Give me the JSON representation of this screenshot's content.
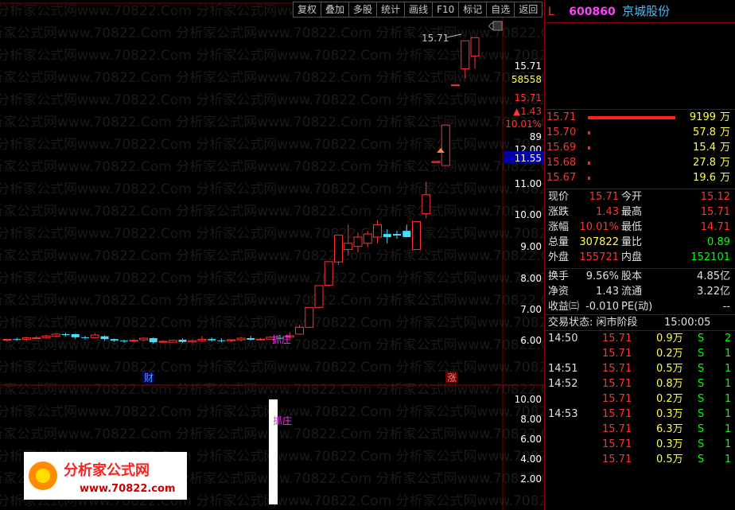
{
  "toolbar": [
    "复权",
    "叠加",
    "多股",
    "统计",
    "画线",
    "F10",
    "标记",
    "自选",
    "返回"
  ],
  "watermark": "分析家公式网www.70822.Com",
  "stock": {
    "flag": "L",
    "code": "600860",
    "name": "京城股份"
  },
  "price_axis": [
    "15.71",
    "58558",
    "15.71",
    "▲1.43",
    "10.01%",
    "89",
    "12.00",
    "11.55",
    "11.00",
    "10.00",
    "9.00",
    "8.00",
    "7.00",
    "6.00"
  ],
  "vol_axis": [
    "10.00",
    "8.00",
    "6.00",
    "4.00",
    "2.00"
  ],
  "markers": {
    "cai": "财",
    "zhang": "涨",
    "zhuazhuang": "抓庄",
    "zhuazhuang2": "抓庄",
    "high_label": "15.71"
  },
  "chart_data": {
    "type": "candlestick",
    "candles": [
      [
        5.99,
        6.01,
        5.95,
        6.03
      ],
      [
        6.02,
        6.0,
        5.96,
        6.06
      ],
      [
        6.01,
        6.06,
        5.98,
        6.1
      ],
      [
        6.06,
        6.06,
        6.03,
        6.12
      ],
      [
        6.07,
        6.12,
        6.04,
        6.17
      ],
      [
        6.11,
        6.18,
        6.08,
        6.22
      ],
      [
        6.18,
        6.15,
        6.11,
        6.22
      ],
      [
        6.18,
        6.08,
        6.03,
        6.2
      ],
      [
        6.08,
        6.07,
        6.01,
        6.12
      ],
      [
        6.07,
        6.15,
        6.04,
        6.22
      ],
      [
        6.11,
        6.02,
        5.98,
        6.14
      ],
      [
        6.02,
        5.97,
        5.93,
        6.04
      ],
      [
        5.97,
        5.96,
        5.9,
        5.99
      ],
      [
        5.96,
        5.98,
        5.93,
        6.02
      ],
      [
        6.0,
        6.05,
        5.96,
        6.07
      ],
      [
        6.05,
        5.92,
        5.88,
        6.07
      ],
      [
        5.92,
        5.95,
        5.9,
        5.98
      ],
      [
        5.92,
        5.98,
        5.92,
        6.0
      ],
      [
        6.0,
        5.93,
        5.9,
        6.04
      ],
      [
        5.93,
        5.97,
        5.9,
        6.0
      ],
      [
        5.97,
        6.01,
        5.92,
        6.12
      ],
      [
        6.02,
        5.98,
        5.95,
        6.07
      ],
      [
        5.98,
        5.97,
        5.92,
        6.04
      ],
      [
        5.97,
        6.0,
        5.92,
        6.02
      ],
      [
        6.0,
        6.05,
        5.95,
        6.09
      ],
      [
        6.05,
        6.0,
        5.97,
        6.12
      ],
      [
        6.0,
        6.02,
        5.97,
        6.06
      ],
      [
        6.02,
        6.08,
        6.0,
        6.12
      ],
      [
        6.06,
        6.05,
        6.0,
        6.12
      ],
      [
        6.08,
        6.13,
        6.03,
        6.24
      ],
      [
        6.18,
        6.4,
        6.16,
        6.48
      ],
      [
        6.4,
        7.04,
        6.38,
        7.04
      ],
      [
        7.04,
        7.74,
        7.0,
        7.74
      ],
      [
        7.75,
        8.51,
        7.7,
        8.51
      ],
      [
        8.5,
        9.36,
        8.4,
        9.36
      ],
      [
        8.9,
        9.1,
        8.7,
        9.7
      ],
      [
        9.0,
        9.3,
        8.8,
        9.45
      ],
      [
        9.1,
        9.4,
        8.98,
        9.5
      ],
      [
        9.3,
        9.7,
        9.1,
        9.85
      ],
      [
        9.4,
        9.3,
        9.1,
        9.55
      ],
      [
        9.4,
        9.35,
        9.25,
        9.5
      ],
      [
        9.5,
        9.3,
        9.3,
        9.7
      ],
      [
        8.9,
        9.8,
        8.9,
        9.8
      ],
      [
        10.05,
        10.66,
        9.9,
        11.08
      ],
      [
        11.7,
        11.73,
        11.7,
        11.73
      ],
      [
        11.6,
        12.9,
        11.6,
        12.9
      ],
      [
        14.19,
        14.19,
        14.19,
        14.19
      ],
      [
        14.71,
        15.61,
        14.4,
        15.61
      ],
      [
        15.12,
        15.71,
        14.71,
        15.71
      ]
    ],
    "vol_spike": 10.0
  },
  "order_book": [
    {
      "p": "15.71",
      "v": "9199",
      "u": "万",
      "bar": true
    },
    {
      "p": "15.70",
      "v": "57.8",
      "u": "万"
    },
    {
      "p": "15.69",
      "v": "15.4",
      "u": "万"
    },
    {
      "p": "15.68",
      "v": "27.8",
      "u": "万"
    },
    {
      "p": "15.67",
      "v": "19.6",
      "u": "万"
    }
  ],
  "quote": [
    [
      "现价",
      "15.71",
      "今开",
      "15.12"
    ],
    [
      "涨跌",
      "1.43",
      "最高",
      "15.71"
    ],
    [
      "涨幅",
      "10.01%",
      "最低",
      "14.71"
    ],
    [
      "总量",
      "307822",
      "量比",
      "0.89"
    ],
    [
      "外盘",
      "155721",
      "内盘",
      "152101"
    ]
  ],
  "stats": [
    [
      "换手",
      "9.56%",
      "股本",
      "4.85亿"
    ],
    [
      "净资",
      "1.43",
      "流通",
      "3.22亿"
    ],
    [
      "收益㈢",
      "-0.010",
      "PE(动)",
      "--"
    ]
  ],
  "status": {
    "label": "交易状态: 闲市阶段",
    "time": "15:00:05"
  },
  "ticks": [
    [
      "14:50",
      "15.71",
      "0.9万",
      "S",
      "2"
    ],
    [
      "",
      "15.71",
      "0.2万",
      "S",
      "1"
    ],
    [
      "14:51",
      "15.71",
      "0.5万",
      "S",
      "1"
    ],
    [
      "14:52",
      "15.71",
      "0.8万",
      "S",
      "1"
    ],
    [
      "",
      "15.71",
      "0.2万",
      "S",
      "1"
    ],
    [
      "14:53",
      "15.71",
      "0.3万",
      "S",
      "1"
    ],
    [
      "",
      "15.71",
      "6.3万",
      "S",
      "1"
    ],
    [
      "",
      "15.71",
      "0.3万",
      "S",
      "1"
    ],
    [
      "",
      "15.71",
      "0.5万",
      "S",
      "1"
    ]
  ],
  "logo": {
    "title": "分析家公式网",
    "url": "www.70822.com"
  }
}
